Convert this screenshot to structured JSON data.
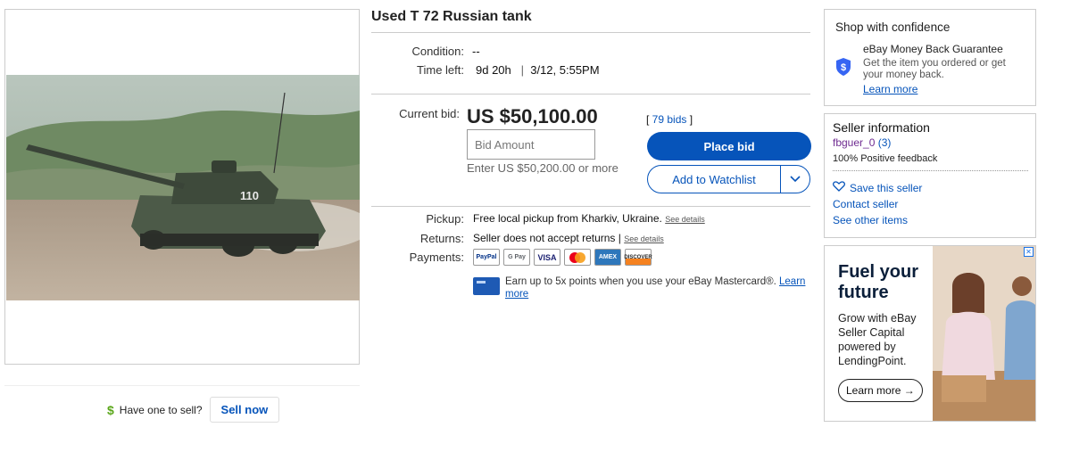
{
  "listing": {
    "title": "Used T 72 Russian tank",
    "condition_label": "Condition:",
    "condition_value": "--",
    "time_left_label": "Time left:",
    "time_left_value": "9d 20h",
    "end_time": "3/12, 5:55PM",
    "current_bid_label": "Current bid:",
    "current_bid_value": "US $50,100.00",
    "bids_count": "79 bids",
    "bid_placeholder": "Bid Amount",
    "enter_note": "Enter US $50,200.00 or more",
    "place_bid_label": "Place bid",
    "watchlist_label": "Add to Watchlist",
    "pickup_label": "Pickup:",
    "pickup_value": "Free local pickup from Kharkiv, Ukraine.",
    "returns_label": "Returns:",
    "returns_value": "Seller does not accept returns |",
    "see_details": "See details",
    "payments_label": "Payments:",
    "payment_methods": [
      "PayPal",
      "G Pay",
      "VISA",
      "Mastercard",
      "AMEX",
      "DISCOVER"
    ],
    "card_note": "Earn up to 5x points when you use your eBay Mastercard®.",
    "card_note_link": "Learn more"
  },
  "image": {
    "tank_marking": "110"
  },
  "sell": {
    "question": "Have one to sell?",
    "button": "Sell now"
  },
  "confidence": {
    "title": "Shop with confidence",
    "guarantee": "eBay Money Back Guarantee",
    "description": "Get the item you ordered or get your money back.",
    "learn_more": "Learn more"
  },
  "seller": {
    "title": "Seller information",
    "name": "fbguer_0",
    "score": "(3)",
    "feedback": "100% Positive feedback",
    "save_label": "Save this seller",
    "contact_label": "Contact seller",
    "other_items_label": "See other items"
  },
  "ad": {
    "headline_1": "Fuel your",
    "headline_2": "future",
    "body": "Grow with eBay Seller Capital powered by LendingPoint.",
    "cta": "Learn more →",
    "close": "✕"
  },
  "colors": {
    "accent": "#0654ba",
    "sell_dollar": "#5ba71b"
  }
}
